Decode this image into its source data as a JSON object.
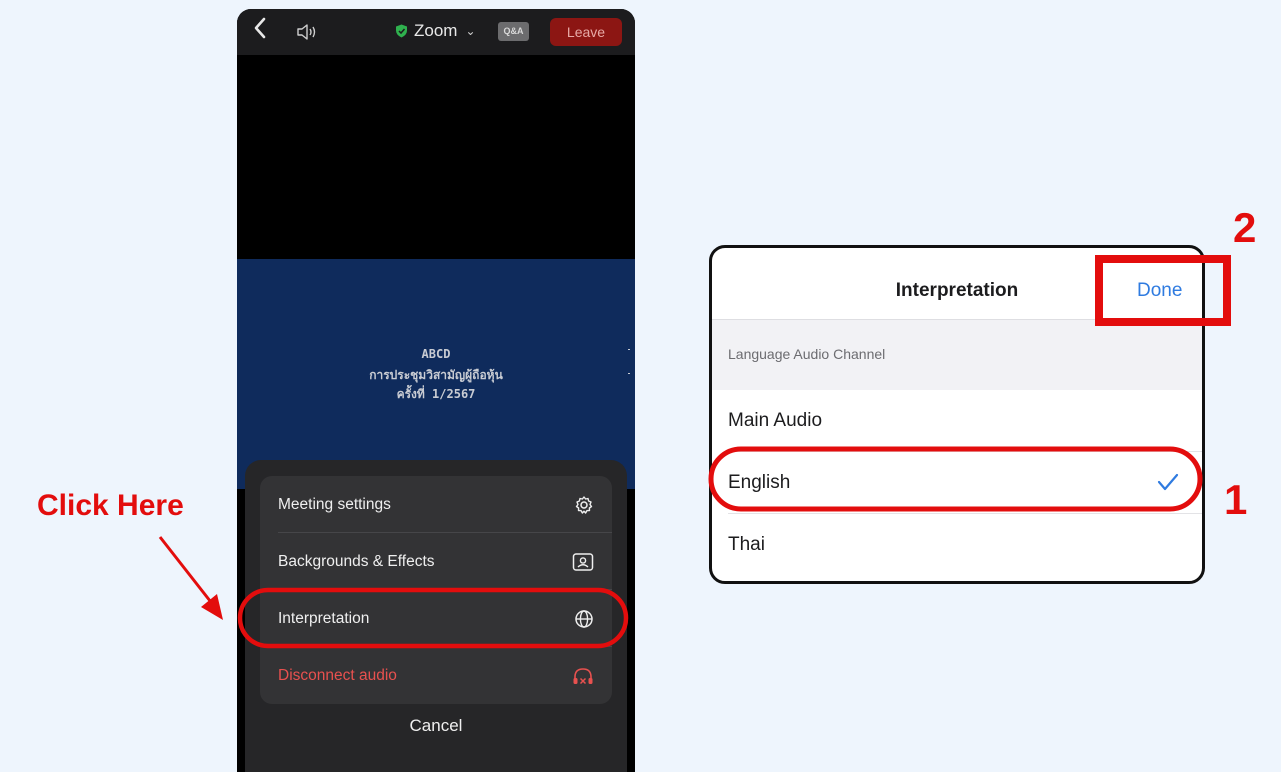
{
  "topbar": {
    "back_icon": "chevron-left-icon",
    "speaker_icon": "speaker-icon",
    "title": "Zoom",
    "title_chevron": "⌄",
    "qa_badge": "Q&A",
    "leave_label": "Leave"
  },
  "slide": {
    "line1": "ABCD",
    "line2": "การประชุมวิสามัญผู้ถือหุ้น",
    "line3": "ครั้งที่ 1/2567"
  },
  "menu": {
    "items": [
      {
        "label": "Meeting settings",
        "icon": "gear-icon"
      },
      {
        "label": "Backgrounds & Effects",
        "icon": "portrait-icon"
      },
      {
        "label": "Interpretation",
        "icon": "globe-icon"
      },
      {
        "label": "Disconnect audio",
        "icon": "headphones-x-icon",
        "color": "#e8514f"
      }
    ],
    "cancel_label": "Cancel"
  },
  "panel": {
    "title": "Interpretation",
    "done_label": "Done",
    "section_label": "Language Audio Channel",
    "options": [
      {
        "label": "Main Audio",
        "selected": false
      },
      {
        "label": "English",
        "selected": true
      },
      {
        "label": "Thai",
        "selected": false
      }
    ]
  },
  "annotations": {
    "click_here": "Click Here",
    "step1": "1",
    "step2": "2",
    "accent_color": "#e30d0d"
  }
}
